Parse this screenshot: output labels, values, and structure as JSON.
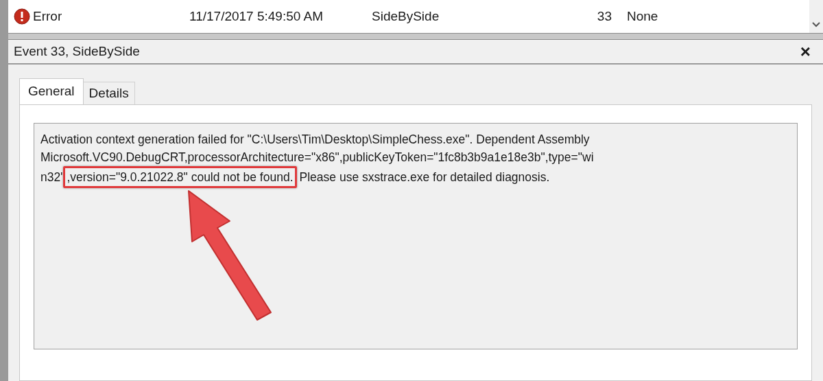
{
  "event_row": {
    "level": "Error",
    "date": "11/17/2017 5:49:50 AM",
    "source": "SideBySide",
    "event_id": "33",
    "task_category": "None"
  },
  "panel": {
    "title": "Event 33, SideBySide",
    "close": "×"
  },
  "tabs": [
    {
      "label": "General",
      "selected": true
    },
    {
      "label": "Details",
      "selected": false
    }
  ],
  "description": {
    "lines": [
      "Activation context generation failed for \"C:\\Users\\Tim\\Desktop\\SimpleChess.exe\". Dependent Assembly",
      "Microsoft.VC90.DebugCRT,processorArchitecture=\"x86\",publicKeyToken=\"1fc8b3b9a1e18e3b\",type=\"wi"
    ],
    "last_line_start": "n32\"",
    "highlighted": ",version=\"9.0.21022.8\" could not be found.",
    "last_line_end": "Please use sxstrace.exe for detailed diagnosis."
  }
}
